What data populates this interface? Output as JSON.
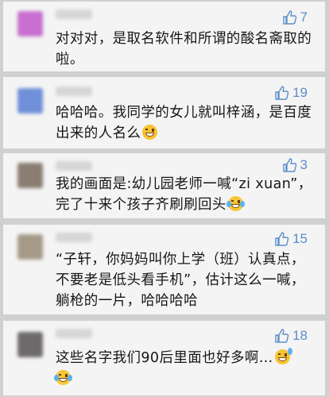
{
  "comments": [
    {
      "likes": "7",
      "text": "对对对，是取名软件和所谓的酸名斋取的啦。",
      "avatar_color": "#c86fcf",
      "emoji": ""
    },
    {
      "likes": "19",
      "text": "哈哈哈。我同学的女儿就叫梓涵，是百度出来的人名么",
      "avatar_color": "#6f8fd8",
      "emoji": "grin"
    },
    {
      "likes": "3",
      "text": "我的画面是:幼儿园老师一喊“zi xuan”，完了十来个孩子齐刷刷回头",
      "avatar_color": "#8a7e72",
      "emoji": "tears"
    },
    {
      "likes": "15",
      "text": "“子轩，你妈妈叫你上学（班）认真点，不要老是低头看手机”，估计这么一喊，躺枪的一片，哈哈哈哈",
      "avatar_color": "#a59a88",
      "emoji": ""
    },
    {
      "likes": "18",
      "text": "这些名字我们90后里面也好多啊…",
      "avatar_color": "#6e6a6a",
      "emoji": "sweat-tears"
    }
  ],
  "colors": {
    "like_blue": "#5b8fc8",
    "card_bg": "#f4f4f4",
    "gap_bg": "#cfd0d2"
  },
  "icons": {
    "like": "thumbs-up-icon",
    "grin": "grinning-face-emoji",
    "tears": "face-with-tears-of-joy-emoji",
    "sweat": "grinning-face-with-sweat-emoji"
  }
}
